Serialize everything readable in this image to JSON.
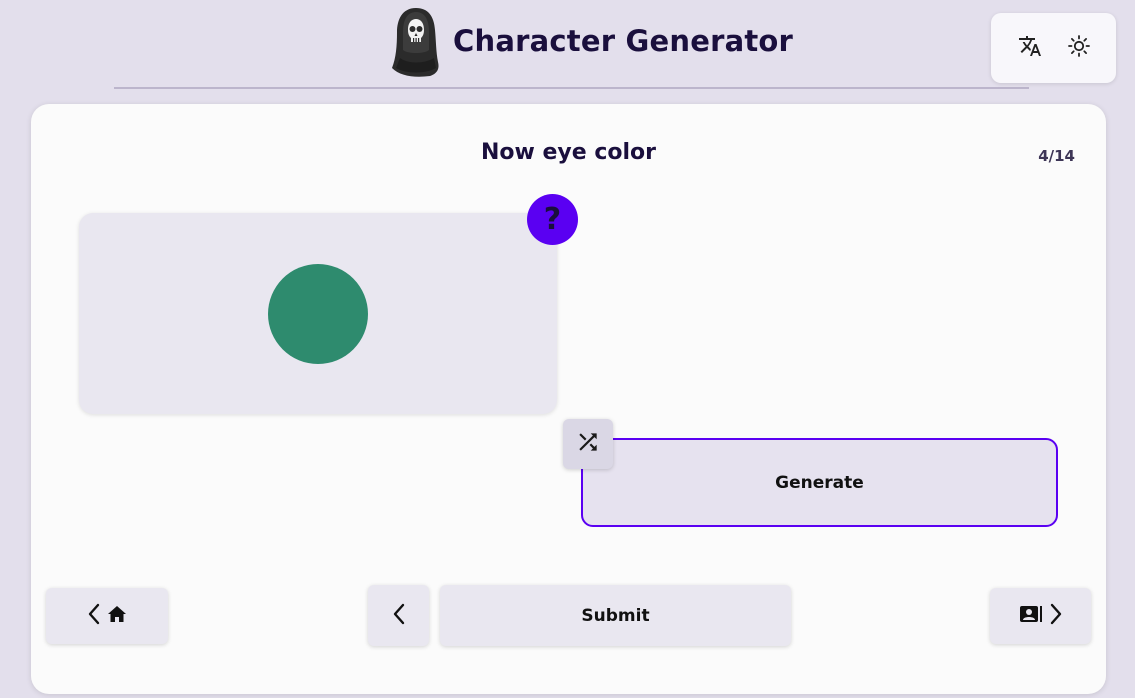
{
  "app": {
    "title": "Character Generator",
    "logo_icon": "hooded-skull-icon"
  },
  "header_actions": {
    "translate_icon": "translate-icon",
    "theme_icon": "sun-icon"
  },
  "question": {
    "title": "Now eye color",
    "progress": "4/14"
  },
  "preview": {
    "swatch_color": "#2e8b6e",
    "help_label": "?"
  },
  "actions": {
    "shuffle_icon": "shuffle-icon",
    "generate_label": "Generate"
  },
  "navigation": {
    "home_icons": [
      "chevron-left-icon",
      "home-icon"
    ],
    "back_icon": "chevron-left-icon",
    "submit_label": "Submit",
    "next_icons": [
      "profile-card-icon",
      "chevron-right-icon"
    ]
  },
  "colors": {
    "accent": "#5a00f2",
    "background": "#e3dfec",
    "card": "#fbfbfb",
    "title": "#1a0f3d"
  }
}
